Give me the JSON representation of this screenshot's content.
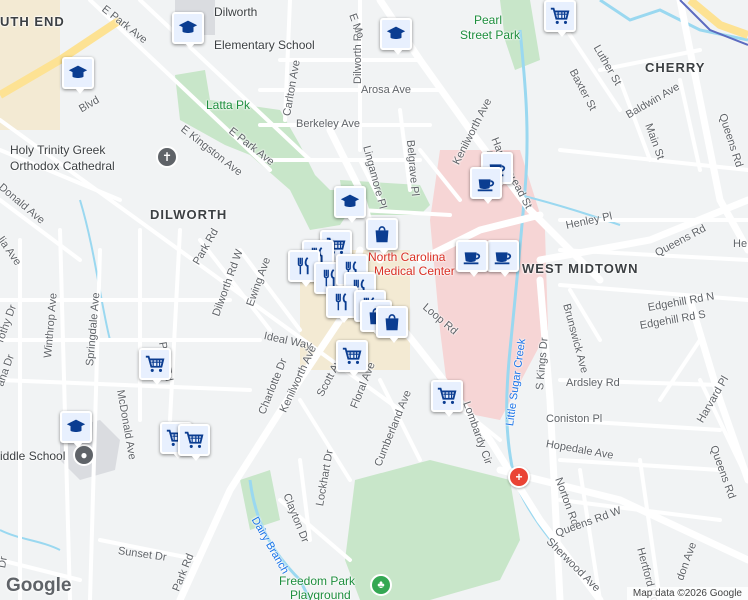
{
  "map": {
    "neighborhoods": {
      "south_end": "UTH END",
      "dilworth": "DILWORTH",
      "cherry": "CHERRY",
      "west_midtown": "WEST MIDTOWN"
    },
    "pois": {
      "dilworth_elementary_line1": "Dilworth",
      "dilworth_elementary_line2": "Elementary School",
      "pearl_street_park_line1": "Pearl",
      "pearl_street_park_line2": "Street Park",
      "latta_park": "Latta Pk",
      "holy_trinity_line1": "Holy Trinity Greek",
      "holy_trinity_line2": "Orthodox Cathedral",
      "medical_center_line1": "North Carolina",
      "medical_center_line2": "Medical Center",
      "middle_school": "iddle School",
      "freedom_park_line1": "Freedom Park",
      "freedom_park_line2": "Playground"
    },
    "streets": {
      "e_park_ave_top": "E Park Ave",
      "dilworth_rd": "Dilworth Rd",
      "e_mo_st": "E Mo",
      "carlton_ave": "Carlton Ave",
      "arosa_ave": "Arosa Ave",
      "berkeley_ave": "Berkeley Ave",
      "lingamore_pl": "Lingamore Pl",
      "belgrave_pl": "Belgrave Pl",
      "kenilworth_ave_ne": "Kenilworth Ave",
      "hardin_pl": "Hardin Pl",
      "e_mo_st_2": "E",
      "ead_st": "ead St",
      "luther_st": "Luther St",
      "baxter_st": "Baxter St",
      "baldwin_ave": "Baldwin Ave",
      "main_st": "Main St",
      "queens_rd_ne": "Queens Rd",
      "queens_rd_e": "Queens Rd",
      "henley_pl": "Henley Pl",
      "he": "He",
      "e_kingston_ave": "E Kingston Ave",
      "e_park_ave": "E Park Ave",
      "blvd": "Blvd",
      "donald_ave": "Donald Ave",
      "lia_ave": "lia Ave",
      "park_rd_top": "Park Rd",
      "dilworth_rd_w": "Dilworth Rd W",
      "ewing_ave": "Ewing Ave",
      "winthrop_ave": "Winthrop Ave",
      "springdale_ave": "Springdale Ave",
      "rothy_dr": "rothy Dr",
      "ana_dr": "ana Dr",
      "park_rd_mid": "Park Rd",
      "mcdonald_ave": "McDonald Ave",
      "ideal_way": "Ideal Way",
      "charlotte_dr": "Charlotte Dr",
      "kenilworth_ave_sw": "Kenilworth Ave",
      "scott_ave": "Scott Ave",
      "floral_ave": "Floral Ave",
      "cumberland_ave": "Cumberland Ave",
      "lombardy_cir": "Lombardy Cir",
      "loop_rd": "Loop Rd",
      "s_kings_dr": "S Kings Dr",
      "brunswick_ave": "Brunswick Ave",
      "edgehill_rd_n": "Edgehill Rd N",
      "edgehill_rd_s": "Edgehill Rd S",
      "ardsley_rd": "Ardsley Rd",
      "coniston_pl": "Coniston Pl",
      "harvard_pl": "Harvard Pl",
      "hopedale_ave": "Hopedale Ave",
      "norton_rd": "Norton Rd",
      "queens_rd_w": "Queens Rd W",
      "queens_rd_s": "Queens Rd",
      "sherwood_ave": "Sherwood Ave",
      "hertford_rd": "Hertford Rd",
      "don_ave": "don Ave",
      "little_sugar_creek": "Little Sugar Creek",
      "lockhart_dr": "Lockhart Dr",
      "clayton_dr": "Clayton Dr",
      "park_rd_bottom": "Park Rd",
      "sunset_dr": "Sunset Dr",
      "dairy_branch": "Dairy Branch",
      "dr_left": "Dr"
    },
    "markers": {
      "school": "school-icon",
      "grocery": "grocery-cart-icon",
      "cafe": "coffee-cup-icon",
      "restaurant": "fork-knife-icon",
      "shopping": "shopping-bag-icon"
    },
    "colors": {
      "background": "#f1f3f4",
      "park": "#c8e6c9",
      "medical": "#f6d5d5",
      "road_major": "#ffffff",
      "highway": "#fde293",
      "water": "#9ad8f0",
      "marker_icon": "#1a73e8"
    },
    "logo": "Google",
    "attribution": "Map data ©2026 Google"
  }
}
